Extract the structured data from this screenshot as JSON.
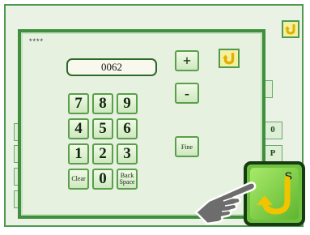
{
  "background_tabs": {
    "right_1": "",
    "right_2": "0",
    "right_3": "P"
  },
  "dialog": {
    "mask_text": "****",
    "display_value": "0062",
    "keypad": [
      [
        "7",
        "8",
        "9"
      ],
      [
        "4",
        "5",
        "6"
      ],
      [
        "1",
        "2",
        "3"
      ]
    ],
    "clear_label": "Clear",
    "zero_label": "0",
    "back_space_label": "Back Space",
    "plus_label": "+",
    "minus_label": "-",
    "fine_label": "Fine"
  },
  "big_button": {
    "letter": "S"
  },
  "colors": {
    "screen_bg": "#e9f2e4",
    "dialog_border": "#3f8f3f",
    "key_border": "#5a9f4c",
    "big_button_fill": "#6fc23f",
    "return_arrow": "#f2c400"
  },
  "icons": {
    "corner_top_right": "return-arrow-icon",
    "dialog_close": "return-arrow-icon",
    "big_button": "return-arrow-icon",
    "pointer": "pointing-hand-icon"
  }
}
